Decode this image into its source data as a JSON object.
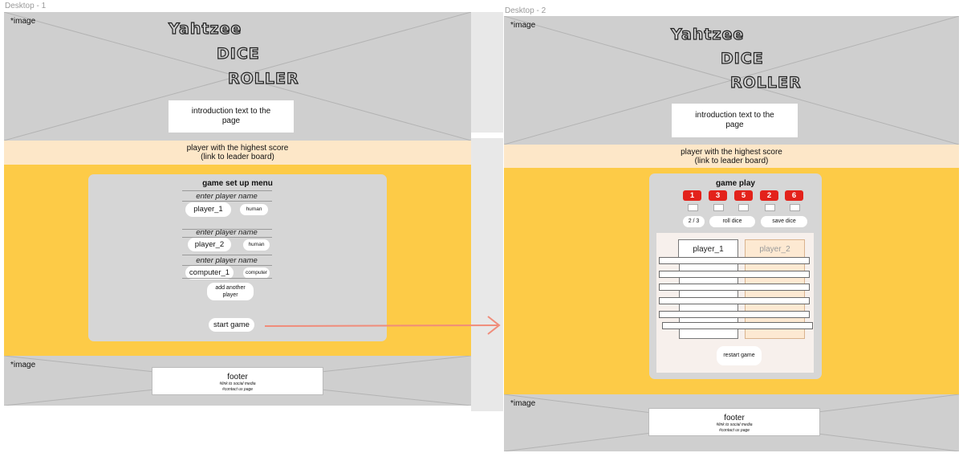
{
  "frames": [
    {
      "label": "Desktop - 1",
      "header": {
        "image_tag": "*image",
        "title_lines": [
          "Yahtzee",
          "DICE",
          "ROLLER"
        ],
        "intro_text": "introduction text to the page"
      },
      "score_bar": {
        "line1": "player with the highest score",
        "line2": "(link to leader board)"
      },
      "setup_menu": {
        "title": "game set up menu",
        "players": [
          {
            "label": "enter player name",
            "name": "player_1",
            "type": "human"
          },
          {
            "label": "enter player name",
            "name": "player_2",
            "type": "human"
          },
          {
            "label": "enter player name",
            "name": "computer_1",
            "type": "computer"
          }
        ],
        "add_player": "add another player",
        "start": "start game"
      },
      "footer": {
        "image_tag": "*image",
        "title": "footer",
        "link1": "#link to social media",
        "link2": "#contact us page"
      }
    },
    {
      "label": "Desktop - 2",
      "header": {
        "image_tag": "*image",
        "title_lines": [
          "Yahtzee",
          "DICE",
          "ROLLER"
        ],
        "intro_text": "introduction text to the page"
      },
      "score_bar": {
        "line1": "player with the highest score",
        "line2": "(link to leader board)"
      },
      "game_play": {
        "title": "game play",
        "dice": [
          "1",
          "3",
          "5",
          "2",
          "6"
        ],
        "roll_counter": "2 / 3",
        "roll_button": "roll dice",
        "save_button": "save dice",
        "columns": [
          "player_1",
          "player_2"
        ],
        "restart": "restart game"
      },
      "footer": {
        "image_tag": "*image",
        "title": "footer",
        "link1": "#link to social media",
        "link2": "#contact us page"
      }
    }
  ],
  "colors": {
    "yellow": "#fdcb47",
    "peach": "#fde7c8",
    "die_red": "#e3221b",
    "arrow": "#f08c7a"
  }
}
